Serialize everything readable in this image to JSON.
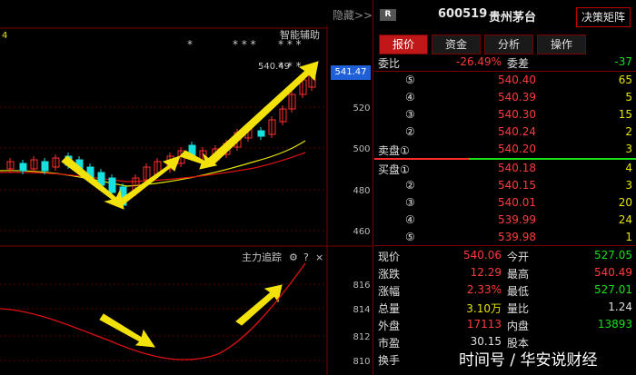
{
  "header": {
    "hide_label": "隐藏>>",
    "r_badge": "R",
    "code": "600519",
    "name": "贵州茅台",
    "decision_button": "决策矩阵"
  },
  "tabs": [
    "报价",
    "资金",
    "分析",
    "操作"
  ],
  "chart": {
    "indicator_label": "智能辅助",
    "corner_label": "4",
    "stars": [
      "*",
      "* * *",
      "* * *",
      "* * *"
    ],
    "last_price_label": "540.49",
    "current_price_tag": "541.47",
    "price_axis": [
      "520",
      "500",
      "480",
      "460"
    ],
    "sub_title": "主力追踪",
    "sub_axis": [
      "816",
      "814",
      "812",
      "810"
    ]
  },
  "orderbook": {
    "ratio_label": "委比",
    "ratio_value": "-26.49%",
    "diff_label": "委差",
    "diff_value": "-37",
    "asks": [
      {
        "n": "⑤",
        "price": "540.40",
        "vol": "65"
      },
      {
        "n": "④",
        "price": "540.39",
        "vol": "5"
      },
      {
        "n": "③",
        "price": "540.30",
        "vol": "15"
      },
      {
        "n": "②",
        "price": "540.24",
        "vol": "2"
      },
      {
        "n": "卖盘①",
        "price": "540.20",
        "vol": "3"
      }
    ],
    "bids": [
      {
        "n": "买盘①",
        "price": "540.18",
        "vol": "4"
      },
      {
        "n": "②",
        "price": "540.15",
        "vol": "3"
      },
      {
        "n": "③",
        "price": "540.01",
        "vol": "20"
      },
      {
        "n": "④",
        "price": "539.99",
        "vol": "24"
      },
      {
        "n": "⑤",
        "price": "539.98",
        "vol": "1"
      }
    ]
  },
  "quote": [
    {
      "l1": "现价",
      "v1": "540.06",
      "c1": "red",
      "l2": "今开",
      "v2": "527.05",
      "c2": "green"
    },
    {
      "l1": "涨跌",
      "v1": "12.29",
      "c1": "red",
      "l2": "最高",
      "v2": "540.49",
      "c2": "red"
    },
    {
      "l1": "涨幅",
      "v1": "2.33%",
      "c1": "red",
      "l2": "最低",
      "v2": "527.01",
      "c2": "green"
    },
    {
      "l1": "总量",
      "v1": "3.10万",
      "c1": "yellow",
      "l2": "量比",
      "v2": "1.24",
      "c2": "white"
    },
    {
      "l1": "外盘",
      "v1": "17113",
      "c1": "red",
      "l2": "内盘",
      "v2": "13893",
      "c2": "green"
    },
    {
      "l1": "市盈",
      "v1": "30.15",
      "c1": "white",
      "l2": "股本",
      "v2": "",
      "c2": "white"
    },
    {
      "l1": "换手",
      "v1": "",
      "c1": "white",
      "l2": "",
      "v2": "",
      "c2": "white"
    }
  ],
  "watermark": "时间号 / 华安说财经",
  "colors": {
    "up": "#ff3b3b",
    "down": "#19e019",
    "accent": "#c01818",
    "tag": "#1f5fd8"
  }
}
